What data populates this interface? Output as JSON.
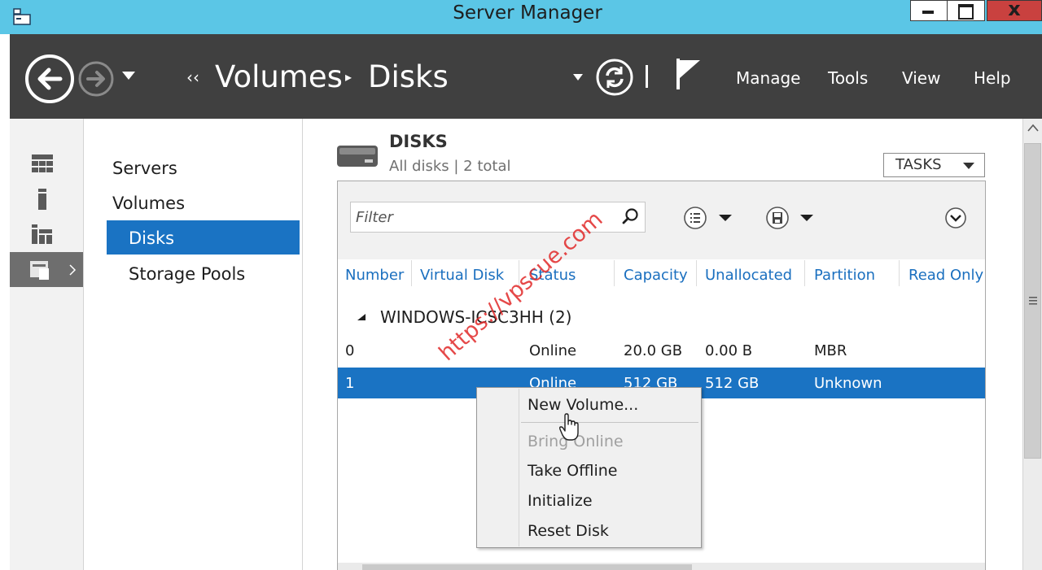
{
  "window": {
    "title": "Server Manager",
    "close_glyph": "x"
  },
  "nav": {
    "breadcrumb_chevrons": "‹‹",
    "breadcrumb": [
      "Volumes",
      "Disks"
    ],
    "breadcrumb_separator": "▸",
    "menus": [
      "Manage",
      "Tools",
      "View",
      "Help"
    ]
  },
  "sidebar": {
    "items": [
      {
        "label": "Servers",
        "selected": false
      },
      {
        "label": "Volumes",
        "selected": false
      },
      {
        "label": "Disks",
        "selected": true
      },
      {
        "label": "Storage Pools",
        "selected": false
      }
    ]
  },
  "disks": {
    "title": "DISKS",
    "subtitle": "All disks | 2 total",
    "tasks_label": "TASKS",
    "filter_placeholder": "Filter",
    "columns": [
      "Number",
      "Virtual Disk",
      "Status",
      "Capacity",
      "Unallocated",
      "Partition",
      "Read Only"
    ],
    "group": "WINDOWS-ICSC3HH (2)",
    "rows": [
      {
        "number": "0",
        "virtual_disk": "",
        "status": "Online",
        "capacity": "20.0 GB",
        "unallocated": "0.00 B",
        "partition": "MBR",
        "selected": false
      },
      {
        "number": "1",
        "virtual_disk": "",
        "status": "Online",
        "capacity": "512 GB",
        "unallocated": "512 GB",
        "partition": "Unknown",
        "selected": true
      }
    ]
  },
  "context_menu": {
    "items": [
      {
        "label": "New Volume...",
        "enabled": true
      },
      {
        "label": "Bring Online",
        "enabled": false
      },
      {
        "label": "Take Offline",
        "enabled": true
      },
      {
        "label": "Initialize",
        "enabled": true
      },
      {
        "label": "Reset Disk",
        "enabled": true
      }
    ]
  },
  "watermark": "https://vpscue.com",
  "icons": {
    "app": "server-manager-icon",
    "back": "back-arrow-icon",
    "forward": "forward-arrow-icon",
    "refresh": "refresh-icon",
    "notifications": "flag-icon",
    "strip": [
      "dashboard-icon",
      "local-server-icon",
      "all-servers-icon",
      "file-storage-icon"
    ],
    "disk": "disk-drive-icon",
    "search": "search-icon",
    "view_options": "list-view-icon",
    "save_query": "save-icon",
    "expand": "expand-icon",
    "cursor": "hand-cursor-icon"
  },
  "colors": {
    "titlebar": "#5bc6e6",
    "nav_band": "#404040",
    "selection": "#1a73c3",
    "column_header": "#1a6fbf",
    "close_button": "#c9413f",
    "watermark": "#e12828"
  }
}
